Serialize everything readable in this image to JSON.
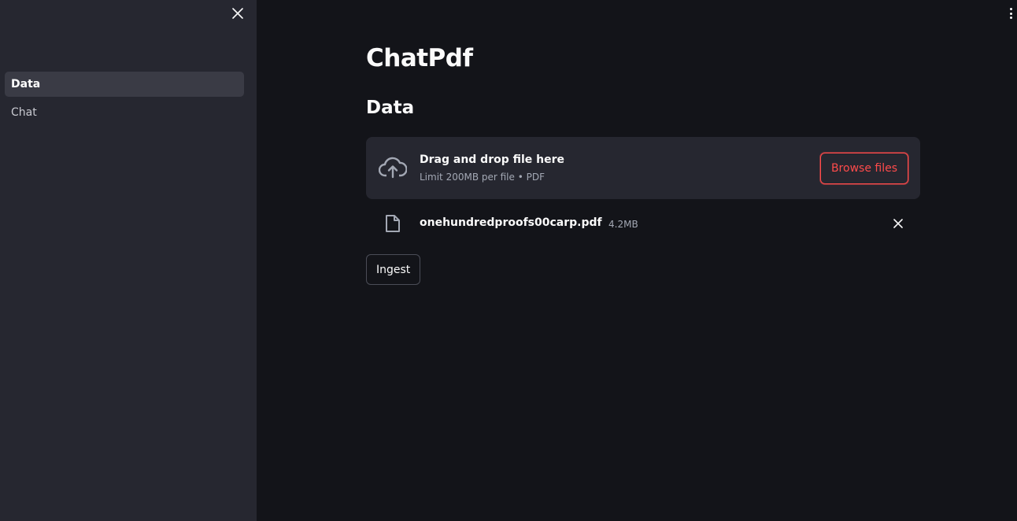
{
  "sidebar": {
    "close_icon": "close-icon",
    "items": [
      {
        "label": "Data",
        "active": true
      },
      {
        "label": "Chat",
        "active": false
      }
    ]
  },
  "main": {
    "title": "ChatPdf",
    "section_title": "Data",
    "menu_icon": "vertical-ellipsis-icon",
    "uploader": {
      "icon": "cloud-upload-icon",
      "drag_text": "Drag and drop file here",
      "limit_text": "Limit 200MB per file • PDF",
      "browse_label": "Browse files"
    },
    "uploaded_file": {
      "icon": "file-icon",
      "name": "onehundredproofs00carp.pdf",
      "size": "4.2MB",
      "remove_icon": "close-icon"
    },
    "ingest_label": "Ingest"
  },
  "colors": {
    "background": "#131419",
    "sidebar": "#262730",
    "accent": "#ff4b4b",
    "text": "#fafafa",
    "muted_text": "#a3a8b4"
  }
}
